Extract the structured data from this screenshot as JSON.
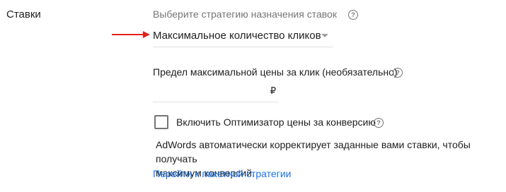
{
  "section_label": "Ставки",
  "strategy": {
    "hint": "Выберите стратегию назначения ставок",
    "selected": "Максимальное количество кликов"
  },
  "bid_limit": {
    "label": "Предел максимальной цены за клик (необязательно)",
    "value": "",
    "currency": "₽"
  },
  "optimizer": {
    "checked": false,
    "label": "Включить Оптимизатор цены за конверсию",
    "description_line1": "AdWords автоматически корректирует заданные вами ставки, чтобы получать",
    "description_line2": "максимум конверсий."
  },
  "portfolio_link": "Перейти к пакетной стратегии",
  "colors": {
    "arrow": "#e2231a",
    "link": "#1a73e8",
    "hint_text": "#757575"
  },
  "icons": {
    "help": "question-circle-icon",
    "arrow": "red-arrow-icon",
    "caret": "dropdown-caret-icon"
  }
}
